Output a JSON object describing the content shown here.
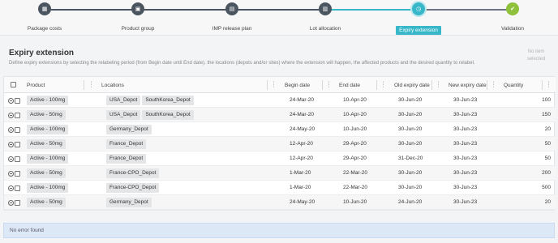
{
  "stepper": {
    "steps": [
      {
        "label": "Package costs",
        "icon": "grid-icon",
        "state": "done-dark"
      },
      {
        "label": "Product group",
        "icon": "box-icon",
        "state": "done-dark"
      },
      {
        "label": "IMP release plan",
        "icon": "document-icon",
        "state": "done-dark"
      },
      {
        "label": "Lot allocation",
        "icon": "calendar-icon",
        "state": "done-dark"
      },
      {
        "label": "Expiry extension",
        "icon": "clock-icon",
        "state": "active"
      },
      {
        "label": "Validation",
        "icon": "check-icon",
        "state": "pending"
      }
    ]
  },
  "header": {
    "title": "Expiry extension",
    "description": "Define expiry extensions by selecting the relabeling period (from Begin date until End date), the locations (depots and/or sites) where the extension will happen, the affected products and the desired quantity to relabel.",
    "selection_info": "No item selected"
  },
  "table": {
    "columns": [
      "Product",
      "Locations",
      "Begin date",
      "End date",
      "Old expiry date",
      "New expiry date",
      "Quantity"
    ],
    "rows": [
      {
        "product": "Active - 100mg",
        "locations": [
          "USA_Depot",
          "SouthKorea_Depot"
        ],
        "begin": "24-Mar-20",
        "end": "10-Apr-20",
        "old_expiry": "30-Jun-20",
        "new_expiry": "30-Jun-23",
        "quantity": "100"
      },
      {
        "product": "Active - 50mg",
        "locations": [
          "USA_Depot",
          "SouthKorea_Depot"
        ],
        "begin": "24-Mar-20",
        "end": "10-Apr-20",
        "old_expiry": "30-Jun-20",
        "new_expiry": "30-Jun-23",
        "quantity": "150"
      },
      {
        "product": "Active - 100mg",
        "locations": [
          "Germany_Depot"
        ],
        "begin": "24-May-20",
        "end": "10-Jun-20",
        "old_expiry": "30-Jun-20",
        "new_expiry": "30-Jun-23",
        "quantity": "20"
      },
      {
        "product": "Active - 50mg",
        "locations": [
          "France_Depot"
        ],
        "begin": "12-Apr-20",
        "end": "29-Apr-20",
        "old_expiry": "30-Jun-20",
        "new_expiry": "30-Jun-23",
        "quantity": "50"
      },
      {
        "product": "Active - 100mg",
        "locations": [
          "France_Depot"
        ],
        "begin": "12-Apr-20",
        "end": "29-Apr-20",
        "old_expiry": "31-Dec-20",
        "new_expiry": "30-Jun-23",
        "quantity": "50"
      },
      {
        "product": "Active - 50mg",
        "locations": [
          "France-CPO_Depot"
        ],
        "begin": "1-Mar-20",
        "end": "22-Mar-20",
        "old_expiry": "30-Jun-20",
        "new_expiry": "30-Jun-23",
        "quantity": "200"
      },
      {
        "product": "Active - 100mg",
        "locations": [
          "France-CPO_Depot"
        ],
        "begin": "1-Mar-20",
        "end": "22-Mar-20",
        "old_expiry": "30-Jun-20",
        "new_expiry": "30-Jun-23",
        "quantity": "500"
      },
      {
        "product": "Active - 50mg",
        "locations": [
          "Germany_Depot"
        ],
        "begin": "24-May-20",
        "end": "10-Jun-20",
        "old_expiry": "24-Jun-20",
        "new_expiry": "30-Jun-23",
        "quantity": "20"
      }
    ]
  },
  "status": {
    "message": "No error found"
  },
  "colors": {
    "active": "#37b7c8",
    "done": "#4a5560",
    "validation": "#8fc13c",
    "status_bg": "#dce8f6"
  }
}
